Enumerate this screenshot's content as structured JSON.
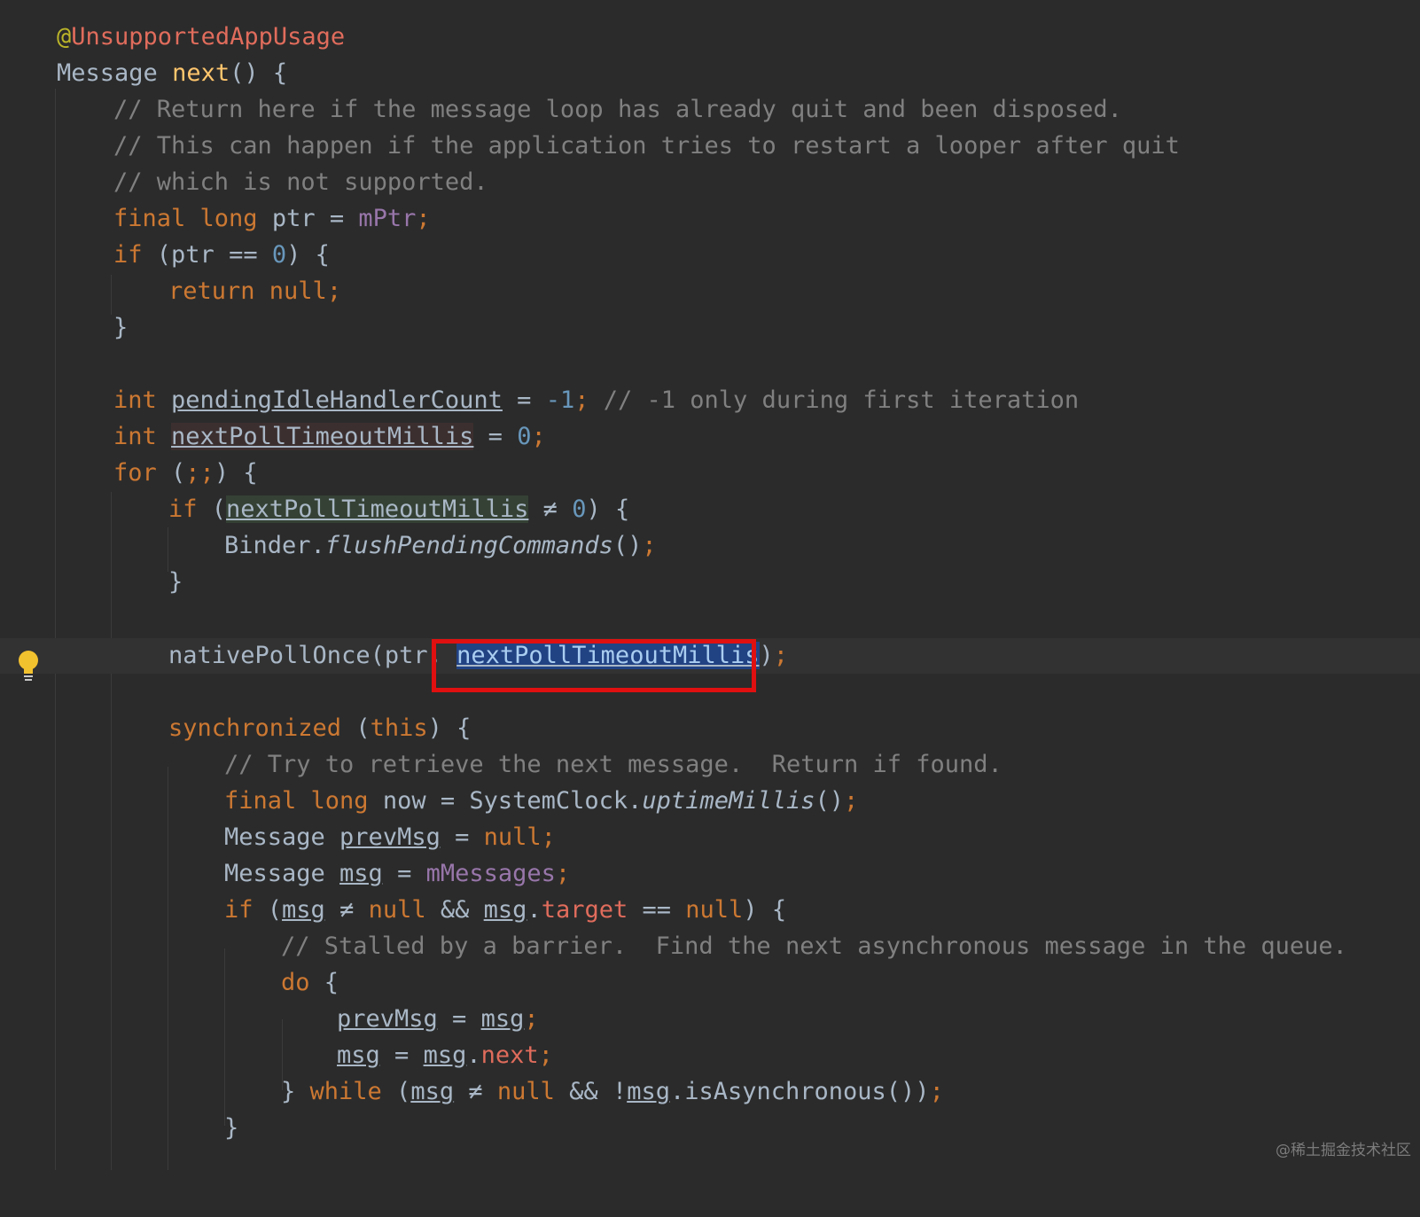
{
  "editor": {
    "annotation": "@UnsupportedAppUsage",
    "method_sig": {
      "type": "Message",
      "name": "next",
      "rest": "() {"
    },
    "comment1": "// Return here if the message loop has already quit and been disposed.",
    "comment2": "// This can happen if the application tries to restart a looper after quit",
    "comment3": "// which is not supported.",
    "l_ptr": {
      "kw": "final long",
      "var": "ptr",
      "eq": " = ",
      "field": "mPtr",
      "semi": ";"
    },
    "l_if": {
      "kw": "if",
      "open": " (ptr ",
      "op": "==",
      "num": "0",
      "close": ") {"
    },
    "l_return": {
      "kw": "return null",
      "semi": ";"
    },
    "close_brace": "}",
    "l_pending": {
      "kw": "int",
      "var": "pendingIdleHandlerCount",
      "eq": " = ",
      "num": "-1",
      "semi": ";",
      "comment": "// -1 only during first iteration"
    },
    "l_next": {
      "kw": "int",
      "var": "nextPollTimeoutMillis",
      "eq": " = ",
      "num": "0",
      "semi": ";"
    },
    "l_for": {
      "kw": "for",
      "open": " (",
      "semis": ";;",
      "close": ") {"
    },
    "l_if2": {
      "kw": "if",
      "open": " (",
      "var": "nextPollTimeoutMillis",
      "op": " ≠ ",
      "num": "0",
      "close": ") {"
    },
    "l_binder": {
      "cls": "Binder.",
      "method": "flushPendingCommands",
      "paren": "()",
      "semi": ";"
    },
    "l_native": {
      "call": "nativePollOnce(ptr",
      "comma": ", ",
      "var": "nextPollTimeoutMillis",
      "close": ")",
      "semi": ";"
    },
    "l_sync": {
      "kw": "synchronized",
      "open": " (",
      "this": "this",
      "close": ") {"
    },
    "comment4": "// Try to retrieve the next message.  Return if found.",
    "l_now": {
      "kw": "final long",
      "rest": " now = SystemClock.",
      "method": "uptimeMillis",
      "paren": "()",
      "semi": ";"
    },
    "l_prev": {
      "type": "Message ",
      "var": "prevMsg",
      "eq": " = ",
      "kw": "null",
      "semi": ";"
    },
    "l_msg": {
      "type": "Message ",
      "var": "msg",
      "eq": " = ",
      "field": "mMessages",
      "semi": ";"
    },
    "l_if3": {
      "kw": "if",
      "open": " (",
      "var1": "msg",
      "op1": " ≠ ",
      "null1": "null",
      "and": " && ",
      "var2": "msg",
      "dot": ".",
      "fld": "target",
      "op2": " == ",
      "null2": "null",
      "close": ") {"
    },
    "comment5": "// Stalled by a barrier.  Find the next asynchronous message in the queue.",
    "l_do": {
      "kw": "do",
      "rest": " {"
    },
    "l_assign1": {
      "var1": "prevMsg",
      "eq": " = ",
      "var2": "msg",
      "semi": ";"
    },
    "l_assign2": {
      "var1": "msg",
      "eq": " = ",
      "var2": "msg",
      "dot": ".",
      "fld": "next",
      "semi": ";"
    },
    "l_while": {
      "brace": "} ",
      "kw": "while",
      "open": " (",
      "var1": "msg",
      "op": " ≠ ",
      "null": "null",
      "and": " && !",
      "var2": "msg",
      "rest": ".isAsynchronous())",
      "semi": ";"
    }
  },
  "watermark": "@稀土掘金技术社区",
  "icons": {
    "intention": "lightbulb-icon"
  },
  "colors": {
    "highlight_box": "#e01010",
    "keyword": "#cc7832",
    "comment": "#808080",
    "number": "#6897bb",
    "field": "#9876aa"
  }
}
